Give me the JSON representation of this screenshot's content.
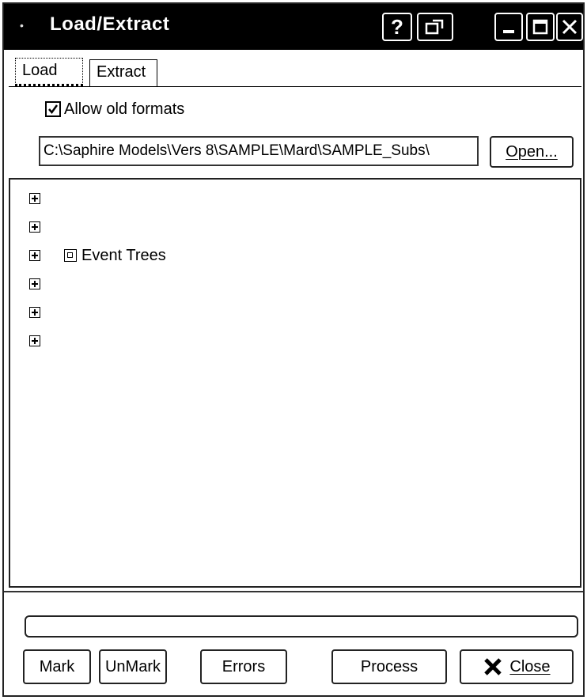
{
  "window": {
    "title": "Load/Extract",
    "title_icon": "app-icon"
  },
  "titlebar_buttons": [
    {
      "name": "help-button",
      "label": "?"
    },
    {
      "name": "restore-context-button",
      "icon": "restore-icon"
    },
    {
      "name": "minimize-button",
      "icon": "minimize-icon"
    },
    {
      "name": "maximize-button",
      "icon": "maximize-icon"
    },
    {
      "name": "close-window-button",
      "icon": "close-icon"
    }
  ],
  "tabs": [
    {
      "label": "Load",
      "active": true
    },
    {
      "label": "Extract",
      "active": false
    }
  ],
  "options": {
    "allow_old_formats_label": "Allow old formats",
    "allow_old_formats_checked": true
  },
  "path": {
    "value": "C:\\Saphire Models\\Vers 8\\SAMPLE\\Mard\\SAMPLE_Subs\\"
  },
  "open_button": {
    "label": "Open..."
  },
  "tree": {
    "items": [
      {
        "label": "",
        "faded": true,
        "has_icon": false
      },
      {
        "label": "",
        "faded": true,
        "has_icon": false
      },
      {
        "label": "Event Trees",
        "faded": false,
        "has_icon": true
      },
      {
        "label": "",
        "faded": true,
        "has_icon": false
      },
      {
        "label": "",
        "faded": true,
        "has_icon": false
      },
      {
        "label": "",
        "faded": true,
        "has_icon": false
      }
    ]
  },
  "progress": {
    "value": 0
  },
  "bottom_buttons": {
    "mark": "Mark",
    "unmark": "UnMark",
    "errors": "Errors",
    "process": "Process",
    "close": "Close"
  }
}
